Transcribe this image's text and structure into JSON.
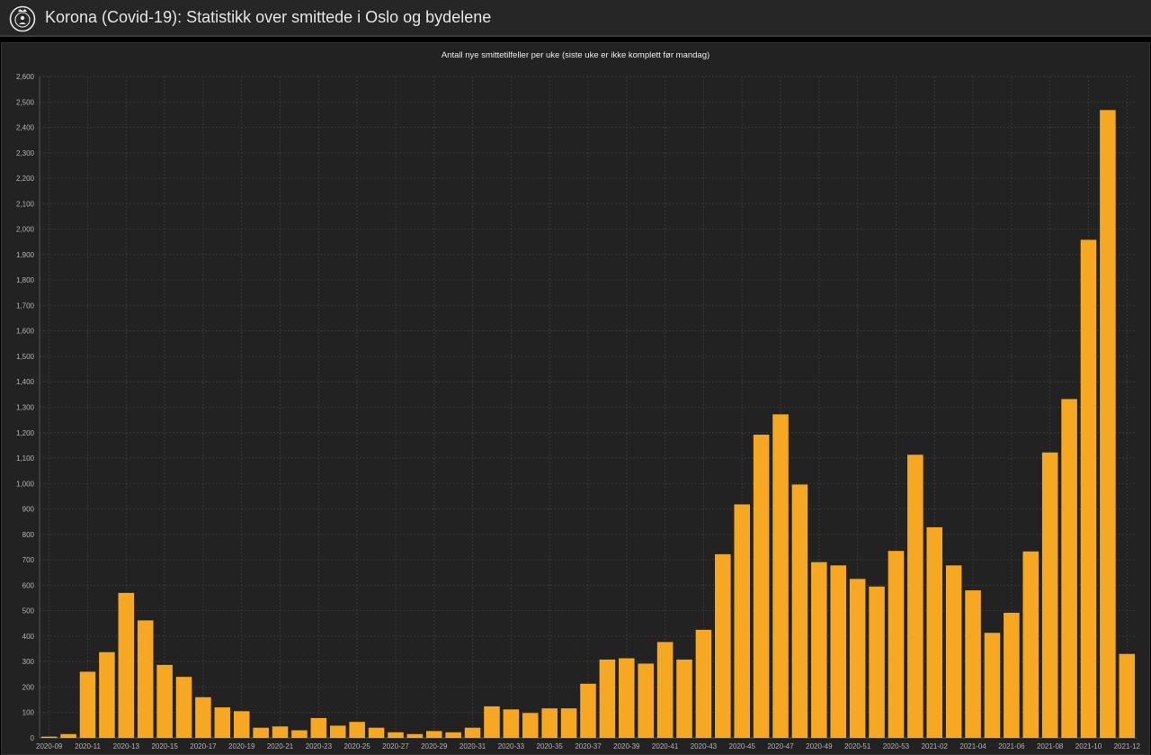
{
  "header": {
    "title": "Korona (Covid-19): Statistikk over smittede i Oslo og bydelene",
    "logo_icon": "oslo-city-seal-icon"
  },
  "colors": {
    "bar": "#F7A823",
    "background": "#222222",
    "header": "#262626",
    "grid": "#3a3a3a",
    "text": "#b4b4b4"
  },
  "chart_data": {
    "type": "bar",
    "title": "Antall nye smittetilfeller per uke (siste uke er ikke komplett før mandag)",
    "xlabel": "",
    "ylabel": "",
    "ylim": [
      0,
      2600
    ],
    "y_ticks": [
      "0",
      "100",
      "200",
      "300",
      "400",
      "500",
      "600",
      "700",
      "800",
      "900",
      "1,000",
      "1,100",
      "1,200",
      "1,300",
      "1,400",
      "1,500",
      "1,600",
      "1,700",
      "1,800",
      "1,900",
      "2,000",
      "2,100",
      "2,200",
      "2,300",
      "2,400",
      "2,500",
      "2,600"
    ],
    "grid": true,
    "legend": "none",
    "categories": [
      "2020-09",
      "2020-10",
      "2020-11",
      "2020-12",
      "2020-13",
      "2020-14",
      "2020-15",
      "2020-16",
      "2020-17",
      "2020-18",
      "2020-19",
      "2020-20",
      "2020-21",
      "2020-22",
      "2020-23",
      "2020-24",
      "2020-25",
      "2020-26",
      "2020-27",
      "2020-28",
      "2020-29",
      "2020-30",
      "2020-31",
      "2020-32",
      "2020-33",
      "2020-34",
      "2020-35",
      "2020-36",
      "2020-37",
      "2020-38",
      "2020-39",
      "2020-40",
      "2020-41",
      "2020-42",
      "2020-43",
      "2020-44",
      "2020-45",
      "2020-46",
      "2020-47",
      "2020-48",
      "2020-49",
      "2020-50",
      "2020-51",
      "2020-52",
      "2020-53",
      "2021-01",
      "2021-02",
      "2021-03",
      "2021-04",
      "2021-05",
      "2021-06",
      "2021-07",
      "2021-08",
      "2021-09",
      "2021-10",
      "2021-11",
      "2021-12"
    ],
    "x_tick_labels": [
      "2020-09",
      "2020-11",
      "2020-13",
      "2020-15",
      "2020-17",
      "2020-19",
      "2020-21",
      "2020-23",
      "2020-25",
      "2020-27",
      "2020-29",
      "2020-31",
      "2020-33",
      "2020-35",
      "2020-37",
      "2020-39",
      "2020-41",
      "2020-43",
      "2020-45",
      "2020-47",
      "2020-49",
      "2020-51",
      "2020-53",
      "2021-02",
      "2021-04",
      "2021-06",
      "2021-08",
      "2021-10",
      "2021-12"
    ],
    "values": [
      5,
      15,
      260,
      337,
      570,
      462,
      287,
      240,
      160,
      120,
      105,
      40,
      45,
      30,
      78,
      48,
      63,
      40,
      22,
      15,
      27,
      22,
      40,
      124,
      112,
      98,
      116,
      116,
      213,
      308,
      313,
      292,
      377,
      308,
      425,
      722,
      918,
      1192,
      1272,
      996,
      691,
      678,
      625,
      595,
      735,
      1113,
      828,
      678,
      580,
      413,
      492,
      733,
      1122,
      1332,
      1958,
      2468,
      330
    ]
  }
}
